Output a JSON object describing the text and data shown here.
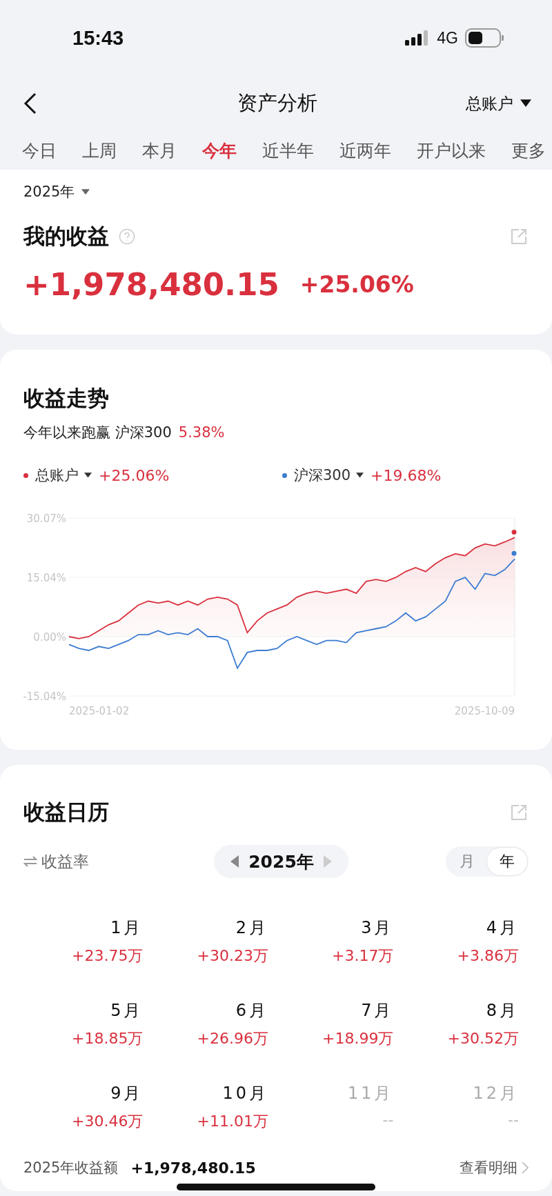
{
  "status_bar": {
    "time": "15:43",
    "network": "4G"
  },
  "header": {
    "title": "资产分析",
    "account": "总账户"
  },
  "tabs": [
    {
      "label": "今日",
      "selected": false
    },
    {
      "label": "上周",
      "selected": false
    },
    {
      "label": "本月",
      "selected": false
    },
    {
      "label": "今年",
      "selected": true
    },
    {
      "label": "近半年",
      "selected": false
    },
    {
      "label": "近两年",
      "selected": false
    },
    {
      "label": "开户以来",
      "selected": false
    },
    {
      "label": "更多",
      "selected": false
    }
  ],
  "summary": {
    "year": "2025年",
    "title": "我的收益",
    "amount": "+1,978,480.15",
    "rate": "+25.06%"
  },
  "trend": {
    "title": "收益走势",
    "subtitle": "今年以来跑赢 沪深300",
    "beat": "5.38%",
    "legend": [
      {
        "value": "+25.06%"
      },
      {
        "value": "+19.68%"
      }
    ],
    "date_range": [
      "2025-01-02",
      "2025-10-09"
    ],
    "chart_data": {
      "type": "line",
      "ylim": [
        -15.04,
        30.07
      ],
      "yticks": [
        {
          "value": 30.07,
          "label": "30.07%"
        },
        {
          "value": 15.04,
          "label": "15.04%"
        },
        {
          "value": 0,
          "label": "0.00%"
        },
        {
          "value": -15.04,
          "label": "-15.04%"
        }
      ],
      "series": [
        {
          "name": "总账户",
          "type": "area",
          "color": "#d9303e",
          "values": [
            0,
            -0.5,
            0,
            1.5,
            3,
            4,
            6,
            8,
            9,
            8.5,
            9,
            8,
            9,
            8,
            9.5,
            10,
            9.5,
            8,
            1,
            4,
            6,
            7,
            8,
            10,
            11,
            11.5,
            11,
            11.5,
            12,
            11,
            14,
            14.5,
            14,
            15,
            16.5,
            17.5,
            16.5,
            18.5,
            20,
            21,
            20.5,
            22.5,
            23.5,
            23,
            24,
            25.1
          ]
        },
        {
          "name": "沪深300",
          "type": "line",
          "color": "#3b7cd0",
          "values": [
            -2,
            -3,
            -3.5,
            -2.5,
            -3,
            -2,
            -1,
            0.5,
            0.5,
            1.5,
            0.5,
            1,
            0.5,
            2,
            0,
            0,
            -1,
            -8,
            -4,
            -3.5,
            -3.5,
            -3,
            -1,
            0,
            -1,
            -2,
            -1,
            -1,
            -1.5,
            1,
            1.5,
            2,
            2.5,
            4,
            6,
            4,
            5,
            7,
            9,
            14,
            15,
            12,
            16,
            15.5,
            17,
            19.7
          ]
        }
      ]
    }
  },
  "calendar": {
    "title": "收益日历",
    "metric": "收益率",
    "year": "2025年",
    "modes": [
      {
        "label": "月",
        "selected": false
      },
      {
        "label": "年",
        "selected": true
      }
    ],
    "months": [
      {
        "label": "1月",
        "value": "+23.75万",
        "disabled": false
      },
      {
        "label": "2月",
        "value": "+30.23万",
        "disabled": false
      },
      {
        "label": "3月",
        "value": "+3.17万",
        "disabled": false
      },
      {
        "label": "4月",
        "value": "+3.86万",
        "disabled": false
      },
      {
        "label": "5月",
        "value": "+18.85万",
        "disabled": false
      },
      {
        "label": "6月",
        "value": "+26.96万",
        "disabled": false
      },
      {
        "label": "7月",
        "value": "+18.99万",
        "disabled": false
      },
      {
        "label": "8月",
        "value": "+30.52万",
        "disabled": false
      },
      {
        "label": "9月",
        "value": "+30.46万",
        "disabled": false
      },
      {
        "label": "10月",
        "value": "+11.01万",
        "disabled": false
      },
      {
        "label": "11月",
        "value": "--",
        "disabled": true
      },
      {
        "label": "12月",
        "value": "--",
        "disabled": true
      }
    ],
    "total_label": "2025年收益额",
    "total": "+1,978,480.15",
    "detail": "查看明细"
  }
}
